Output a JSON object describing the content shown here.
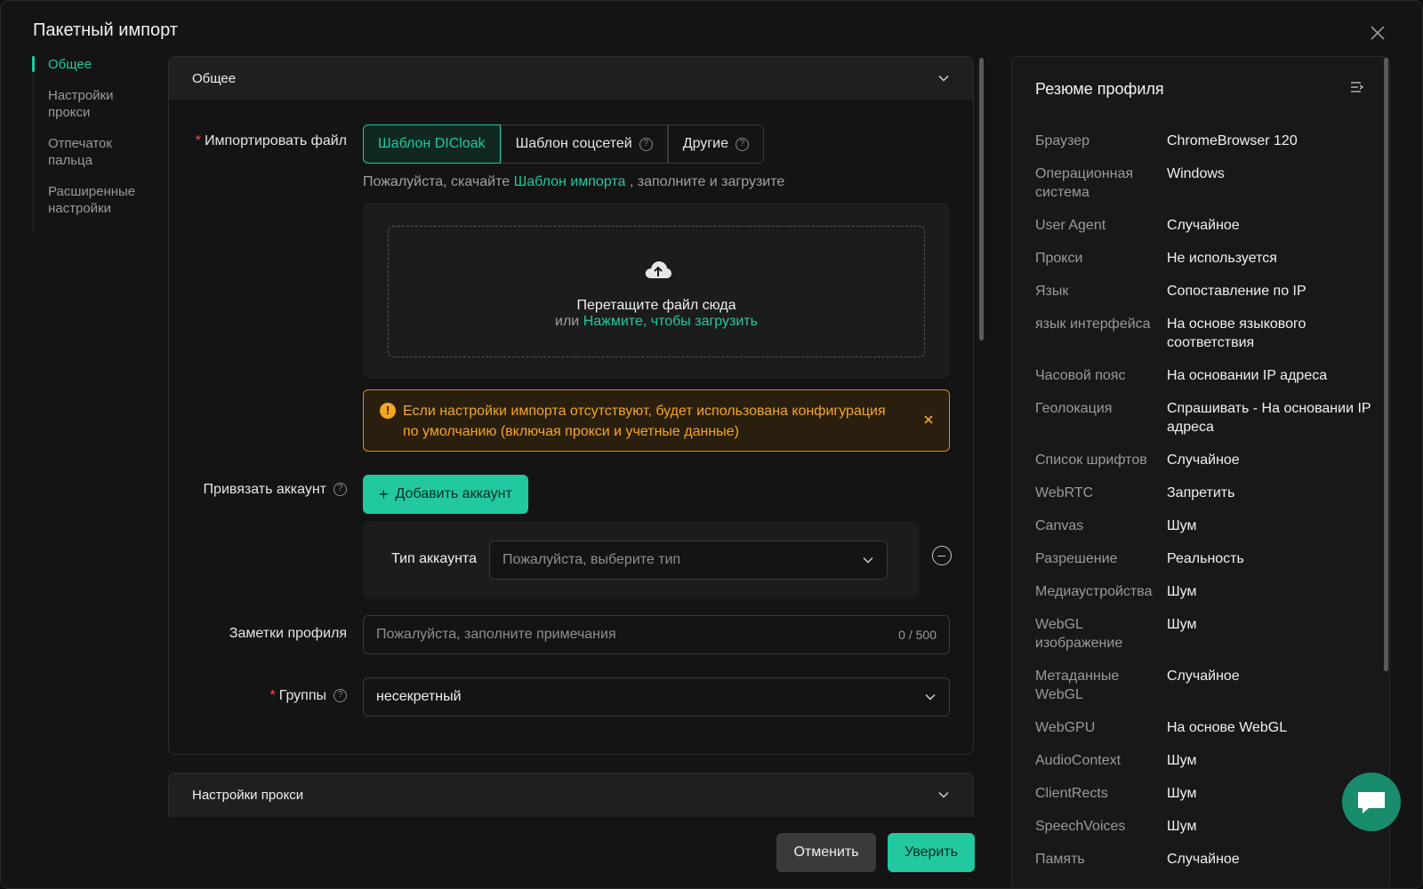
{
  "dialog": {
    "title": "Пакетный импорт"
  },
  "nav": {
    "items": [
      {
        "label": "Общее"
      },
      {
        "label": "Настройки прокси"
      },
      {
        "label": "Отпечаток пальца"
      },
      {
        "label": "Расширенные настройки"
      }
    ]
  },
  "general": {
    "section_title": "Общее",
    "import_label": "Импортировать файл",
    "templates": [
      {
        "label": "Шаблон DICloak"
      },
      {
        "label": "Шаблон соцсетей"
      },
      {
        "label": "Другие"
      }
    ],
    "hint_prefix": "Пожалуйста, скачайте",
    "hint_link": "Шаблон импорта",
    "hint_suffix": ", заполните и загрузите",
    "drop_text": "Перетащите файл сюда",
    "drop_or": "или",
    "drop_link": "Нажмите, чтобы загрузить",
    "alert_text": "Если настройки импорта отсутствуют, будет использована конфигурация по умолчанию (включая прокси и учетные данные)",
    "bind_label": "Привязать аккаунт",
    "add_account": "Добавить аккаунт",
    "account_type_label": "Тип аккаунта",
    "account_type_placeholder": "Пожалуйста, выберите тип",
    "notes_label": "Заметки профиля",
    "notes_placeholder": "Пожалуйста, заполните примечания",
    "notes_counter": "0 / 500",
    "groups_label": "Группы",
    "groups_value": "несекретный"
  },
  "proxy": {
    "section_title": "Настройки прокси"
  },
  "footer": {
    "cancel": "Отменить",
    "ok": "Уверить"
  },
  "summary": {
    "title": "Резюме профиля",
    "rows": [
      {
        "key": "Браузер",
        "value": "ChromeBrowser 120"
      },
      {
        "key": "Операционная система",
        "value": "Windows"
      },
      {
        "key": "User Agent",
        "value": "Случайное"
      },
      {
        "key": "Прокси",
        "value": "Не используется"
      },
      {
        "key": "Язык",
        "value": "Сопоставление по IP"
      },
      {
        "key": "язык интерфейса",
        "value": "На основе языкового соответствия"
      },
      {
        "key": "Часовой пояс",
        "value": "На основании IP адреса"
      },
      {
        "key": "Геолокация",
        "value": "Спрашивать - На основании IP адреса"
      },
      {
        "key": "Список шрифтов",
        "value": "Случайное"
      },
      {
        "key": "WebRTC",
        "value": "Запретить"
      },
      {
        "key": "Canvas",
        "value": "Шум"
      },
      {
        "key": "Разрешение",
        "value": "Реальность"
      },
      {
        "key": "Медиаустройства",
        "value": "Шум"
      },
      {
        "key": "WebGL изображение",
        "value": "Шум"
      },
      {
        "key": "Метаданные WebGL",
        "value": "Случайное"
      },
      {
        "key": "WebGPU",
        "value": "На основе WebGL"
      },
      {
        "key": "AudioContext",
        "value": "Шум"
      },
      {
        "key": "ClientRects",
        "value": "Шум"
      },
      {
        "key": "SpeechVoices",
        "value": "Шум"
      },
      {
        "key": "Память",
        "value": "Случайное"
      }
    ]
  },
  "colors": {
    "accent": "#21c8a0",
    "warning": "#f5a623",
    "required": "#ff4d4f"
  },
  "icons": [
    "close-icon",
    "chevron-down-icon",
    "help-icon",
    "upload-cloud-icon",
    "warning-icon",
    "plus-icon",
    "minus-circle-icon",
    "collapse-panel-icon",
    "chat-icon"
  ]
}
